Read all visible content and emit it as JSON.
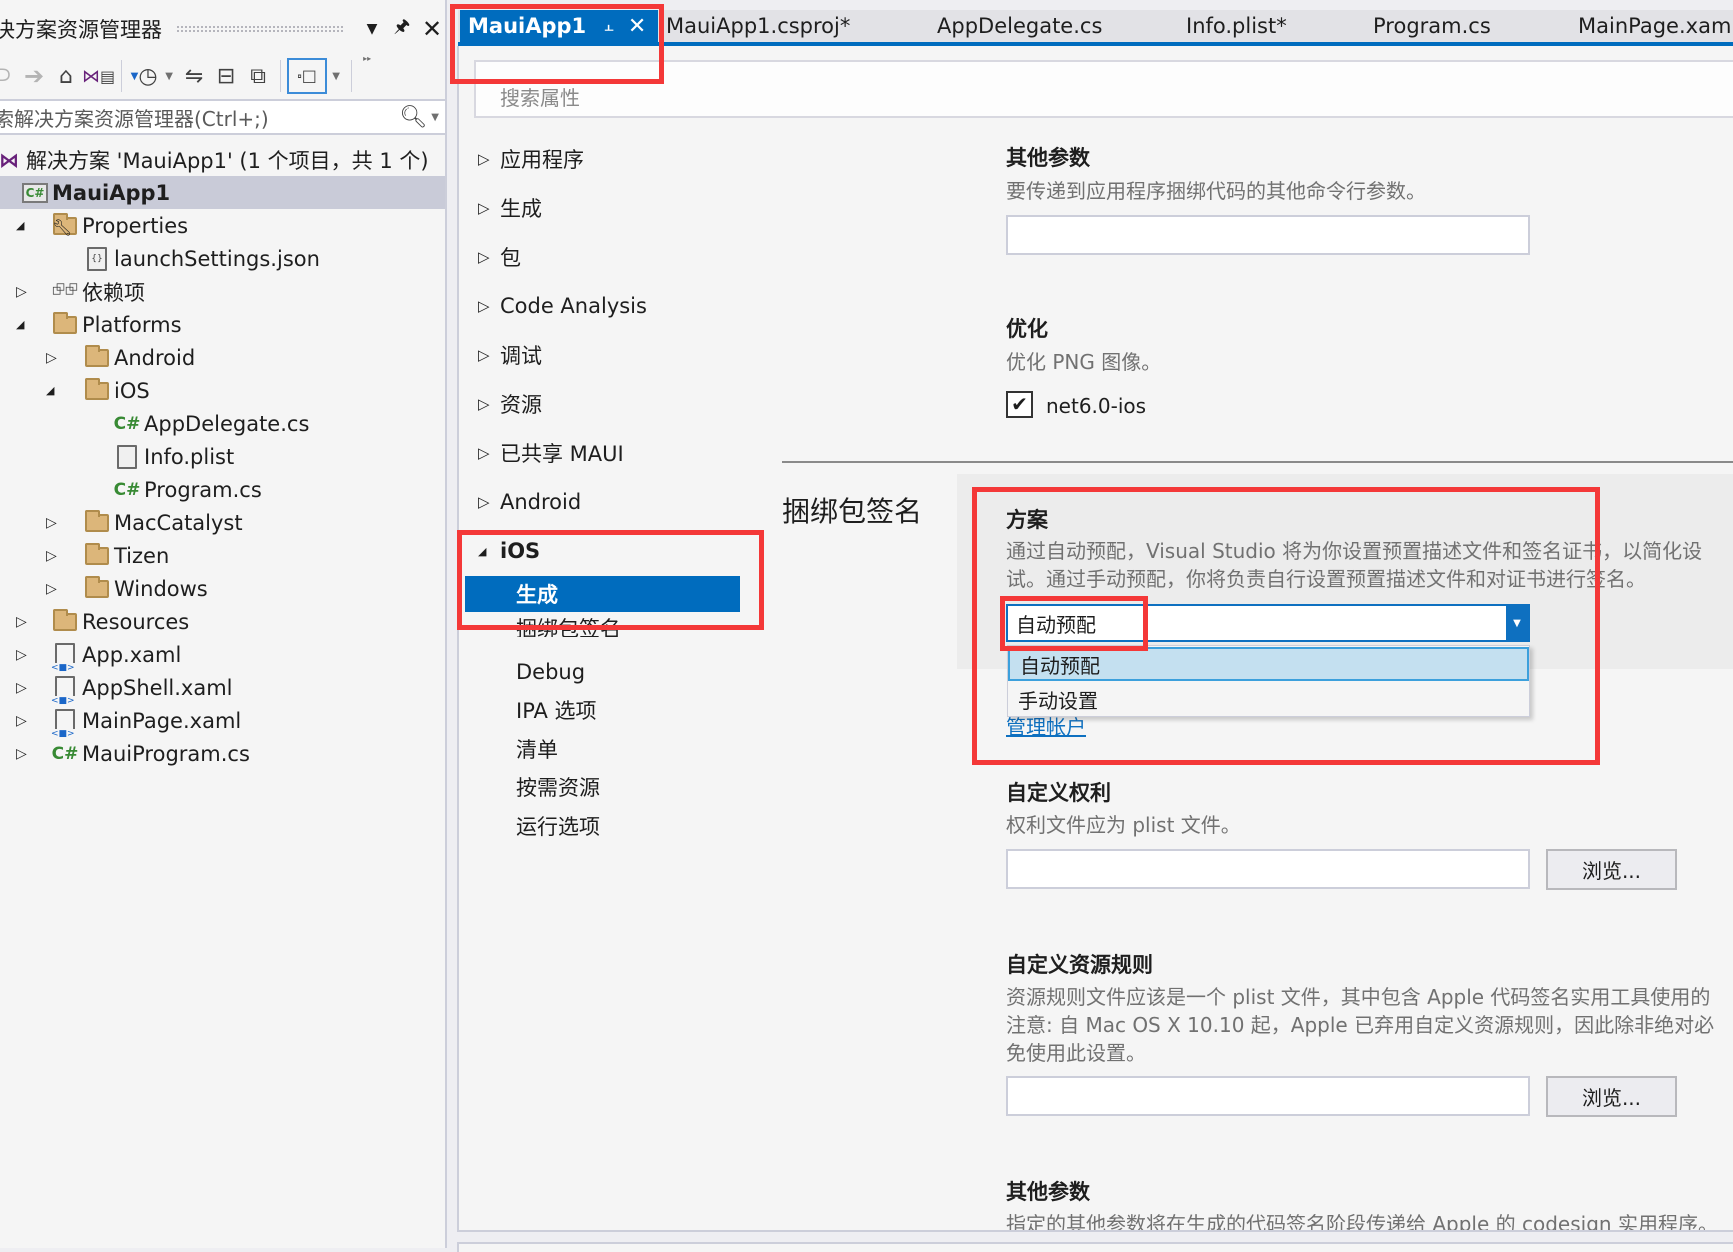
{
  "solution_explorer": {
    "title": "决方案资源管理器",
    "search_placeholder": "索解决方案资源管理器(Ctrl+;)",
    "toolbar": [
      "back",
      "forward",
      "home",
      "vs-switch-views",
      "pending-changes-filter",
      "sync-with-active-document",
      "collapse-all",
      "show-all-files",
      "properties-view"
    ],
    "tree": [
      {
        "label": "解决方案 'MauiApp1' (1 个项目，共 1 个)",
        "icon": "solution-icon",
        "level": 0,
        "expander": "none"
      },
      {
        "label": "MauiApp1",
        "icon": "csharp-project-icon",
        "level": 0,
        "expander": "none",
        "selected": true
      },
      {
        "label": "Properties",
        "icon": "properties-folder-icon",
        "level": 1,
        "expander": "expanded"
      },
      {
        "label": "launchSettings.json",
        "icon": "json-file-icon",
        "level": 2,
        "expander": "none"
      },
      {
        "label": "依赖项",
        "icon": "dependencies-icon",
        "level": 1,
        "expander": "collapsed"
      },
      {
        "label": "Platforms",
        "icon": "folder-icon",
        "level": 1,
        "expander": "expanded"
      },
      {
        "label": "Android",
        "icon": "folder-icon",
        "level": 2,
        "expander": "collapsed"
      },
      {
        "label": "iOS",
        "icon": "folder-icon",
        "level": 2,
        "expander": "expanded"
      },
      {
        "label": "AppDelegate.cs",
        "icon": "csharp-file-icon",
        "level": 3,
        "expander": "none"
      },
      {
        "label": "Info.plist",
        "icon": "file-icon",
        "level": 3,
        "expander": "none"
      },
      {
        "label": "Program.cs",
        "icon": "csharp-file-icon",
        "level": 3,
        "expander": "none"
      },
      {
        "label": "MacCatalyst",
        "icon": "folder-icon",
        "level": 2,
        "expander": "collapsed"
      },
      {
        "label": "Tizen",
        "icon": "folder-icon",
        "level": 2,
        "expander": "collapsed"
      },
      {
        "label": "Windows",
        "icon": "folder-icon",
        "level": 2,
        "expander": "collapsed"
      },
      {
        "label": "Resources",
        "icon": "folder-icon",
        "level": 1,
        "expander": "collapsed"
      },
      {
        "label": "App.xaml",
        "icon": "xaml-file-icon",
        "level": 1,
        "expander": "collapsed"
      },
      {
        "label": "AppShell.xaml",
        "icon": "xaml-file-icon",
        "level": 1,
        "expander": "collapsed"
      },
      {
        "label": "MainPage.xaml",
        "icon": "xaml-file-icon",
        "level": 1,
        "expander": "collapsed"
      },
      {
        "label": "MauiProgram.cs",
        "icon": "csharp-file-icon",
        "level": 1,
        "expander": "collapsed"
      }
    ]
  },
  "tabs": [
    {
      "label": "MauiApp1",
      "active": true
    },
    {
      "label": "MauiApp1.csproj*"
    },
    {
      "label": "AppDelegate.cs"
    },
    {
      "label": "Info.plist*"
    },
    {
      "label": "Program.cs"
    },
    {
      "label": "MainPage.xaml"
    }
  ],
  "properties": {
    "search_placeholder": "搜索属性",
    "nav": [
      {
        "label": "应用程序"
      },
      {
        "label": "生成"
      },
      {
        "label": "包"
      },
      {
        "label": "Code Analysis"
      },
      {
        "label": "调试"
      },
      {
        "label": "资源"
      },
      {
        "label": "已共享 MAUI"
      },
      {
        "label": "Android"
      },
      {
        "label": "iOS",
        "expanded": true
      }
    ],
    "ios_sub": [
      "生成",
      "捆绑包签名",
      "Debug",
      "IPA 选项",
      "清单",
      "按需资源",
      "运行选项"
    ],
    "ios_selected": "生成",
    "sections": {
      "other_args_top": {
        "title": "其他参数",
        "desc": "要传递到应用程序捆绑代码的其他命令行参数。",
        "value": ""
      },
      "optimize": {
        "title": "优化",
        "desc": "优化 PNG 图像。",
        "checkbox_label": "net6.0-ios",
        "checked": true
      },
      "bundle_signing_heading": "捆绑包签名",
      "scheme": {
        "title": "方案",
        "desc_line1": "通过自动预配，Visual Studio 将为你设置预置描述文件和签名证书，以简化设",
        "desc_line2": "试。通过手动预配，你将负责自行设置预置描述文件和对证书进行签名。",
        "selected": "自动预配",
        "options": [
          "自动预配",
          "手动设置"
        ],
        "highlighted_option": "自动预配",
        "manage_link": "管理帐户"
      },
      "entitlements": {
        "title": "自定义权利",
        "desc": "权利文件应为 plist 文件。",
        "value": "",
        "browse": "浏览..."
      },
      "resource_rules": {
        "title": "自定义资源规则",
        "desc_line1": "资源规则文件应该是一个 plist 文件，其中包含 Apple 代码签名实用工具使用的",
        "desc_line2": "注意: 自 Mac OS X 10.10 起，Apple 已弃用自定义资源规则，因此除非绝对必",
        "desc_line3": "免使用此设置。",
        "value": "",
        "browse": "浏览..."
      },
      "other_args_bottom": {
        "title": "其他参数",
        "desc": "指定的其他参数将在生成的代码签名阶段传递给 Apple 的 codesign 实用程序。"
      }
    }
  },
  "colors": {
    "accent": "#006cbe",
    "highlight_box": "#f43838",
    "link": "#0e70c0",
    "dropdown_highlight": "#c4e0f0"
  }
}
